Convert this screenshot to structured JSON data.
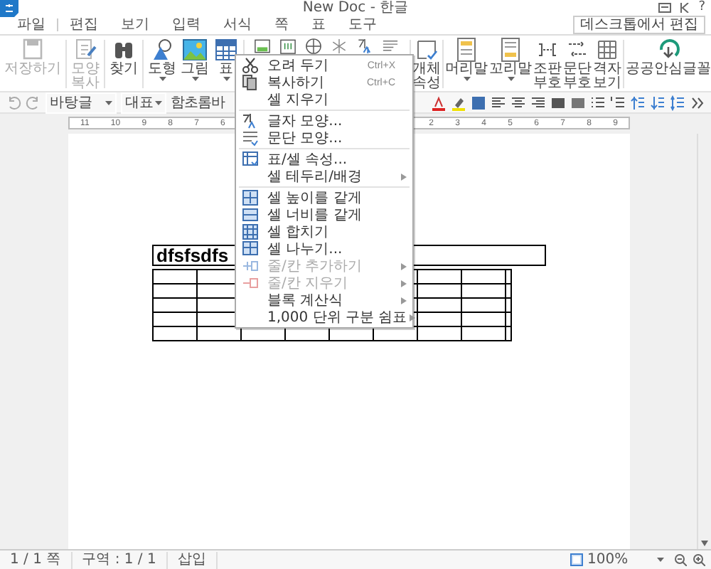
{
  "window": {
    "title": "New Doc - 한글",
    "help": "?"
  },
  "menu_tabs": [
    {
      "label": "파일",
      "selected": false
    },
    {
      "label": "편집",
      "selected": false
    },
    {
      "label": "보기",
      "selected": false
    },
    {
      "label": "입력",
      "selected": false
    },
    {
      "label": "서식",
      "selected": false
    },
    {
      "label": "쪽",
      "selected": false
    },
    {
      "label": "표",
      "selected": false
    },
    {
      "label": "도구",
      "selected": false
    }
  ],
  "edit_button": "데스크톱에서 편집",
  "ribbon": [
    {
      "kind": "save",
      "label": "저장하기",
      "disabled": true,
      "caret": false
    },
    {
      "kind": "divider"
    },
    {
      "kind": "format-copy",
      "label": "모양 복사",
      "disabled": true,
      "caret": false
    },
    {
      "kind": "divider"
    },
    {
      "kind": "find",
      "label": "찾기",
      "disabled": false,
      "caret": false
    },
    {
      "kind": "divider"
    },
    {
      "kind": "shape",
      "label": "도형",
      "disabled": false,
      "caret": true
    },
    {
      "kind": "picture",
      "label": "그림",
      "disabled": false,
      "caret": true
    },
    {
      "kind": "table",
      "label": "표",
      "disabled": false,
      "caret": true
    },
    {
      "kind": "divider"
    },
    {
      "kind": "chart"
    },
    {
      "kind": "textbox"
    },
    {
      "kind": "globe"
    },
    {
      "kind": "asterisk"
    },
    {
      "kind": "char-shape"
    },
    {
      "kind": "para-shape"
    },
    {
      "kind": "divider"
    },
    {
      "kind": "object",
      "label": "개체 속성",
      "disabled": false,
      "caret": false
    },
    {
      "kind": "divider"
    },
    {
      "kind": "header",
      "label": "머리말",
      "disabled": false,
      "caret": true
    },
    {
      "kind": "footer",
      "label": "꼬리말",
      "disabled": false,
      "caret": true
    },
    {
      "kind": "code",
      "label": "조판 부호",
      "disabled": false,
      "caret": false
    },
    {
      "kind": "para-mark",
      "label": "문단 부호",
      "disabled": false,
      "caret": false
    },
    {
      "kind": "grid",
      "label": "격자 보기",
      "disabled": false,
      "caret": false
    },
    {
      "kind": "divider"
    },
    {
      "kind": "safe-font",
      "label": "공공안심글꼴",
      "disabled": false,
      "caret": false
    }
  ],
  "format_bar": {
    "style": "바탕글",
    "language": "대표",
    "font": "함초롬바"
  },
  "ruler": {
    "left_numbers": [
      "11",
      "10",
      "9",
      "8",
      "7",
      "6"
    ],
    "right_numbers": [
      "2",
      "3",
      "4",
      "5",
      "6",
      "7",
      "8",
      "9"
    ]
  },
  "document": {
    "table_title": "dfsfsdfs"
  },
  "context_menu": [
    {
      "kind": "cut",
      "label": "오려 두기",
      "shortcut": "Ctrl+X",
      "disabled": false,
      "submenu": false
    },
    {
      "kind": "copy",
      "label": "복사하기",
      "shortcut": "Ctrl+C",
      "disabled": false,
      "submenu": false
    },
    {
      "kind": "plain",
      "label": "셀 지우기",
      "disabled": false,
      "submenu": false
    },
    {
      "kind": "separator"
    },
    {
      "kind": "char-shape",
      "label": "글자 모양...",
      "disabled": false,
      "submenu": false
    },
    {
      "kind": "para-shape",
      "label": "문단 모양...",
      "disabled": false,
      "submenu": false
    },
    {
      "kind": "separator"
    },
    {
      "kind": "cell-props",
      "label": "표/셀 속성...",
      "disabled": false,
      "submenu": false
    },
    {
      "kind": "plain",
      "label": "셀 테두리/배경",
      "disabled": false,
      "submenu": true
    },
    {
      "kind": "separator"
    },
    {
      "kind": "same-height",
      "label": "셀 높이를 같게",
      "disabled": false,
      "submenu": false
    },
    {
      "kind": "same-width",
      "label": "셀 너비를 같게",
      "disabled": false,
      "submenu": false
    },
    {
      "kind": "merge",
      "label": "셀 합치기",
      "disabled": false,
      "submenu": false
    },
    {
      "kind": "split",
      "label": "셀 나누기...",
      "disabled": false,
      "submenu": false
    },
    {
      "kind": "add-row",
      "label": "줄/칸 추가하기",
      "disabled": true,
      "submenu": true
    },
    {
      "kind": "del-row",
      "label": "줄/칸 지우기",
      "disabled": true,
      "submenu": true
    },
    {
      "kind": "plain",
      "label": "블록 계산식",
      "disabled": false,
      "submenu": true
    },
    {
      "kind": "plain",
      "label": "1,000 단위 구분 쉼표",
      "disabled": false,
      "submenu": true
    }
  ],
  "status_bar": {
    "page": "1 / 1 쪽",
    "section": "구역 : 1 / 1",
    "mode": "삽입",
    "zoom": "100%"
  }
}
